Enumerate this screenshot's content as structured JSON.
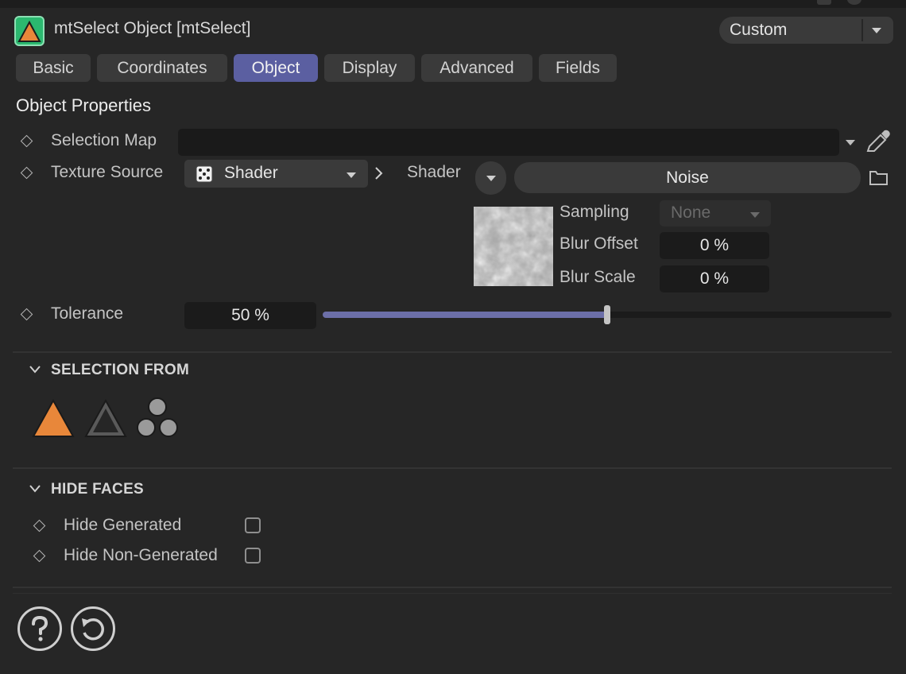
{
  "header": {
    "title": "mtSelect Object [mtSelect]",
    "preset": "Custom",
    "icon": "triangle-object-icon"
  },
  "tabs": [
    {
      "label": "Basic",
      "active": false
    },
    {
      "label": "Coordinates",
      "active": false
    },
    {
      "label": "Object",
      "active": true
    },
    {
      "label": "Display",
      "active": false
    },
    {
      "label": "Advanced",
      "active": false
    },
    {
      "label": "Fields",
      "active": false
    }
  ],
  "section_title": "Object Properties",
  "selection_map": {
    "label": "Selection Map",
    "value": ""
  },
  "texture_source": {
    "label": "Texture Source",
    "value": "Shader"
  },
  "shader": {
    "label": "Shader",
    "name": "Noise",
    "sampling_label": "Sampling",
    "sampling_value": "None",
    "blur_offset_label": "Blur Offset",
    "blur_offset_value": "0 %",
    "blur_scale_label": "Blur Scale",
    "blur_scale_value": "0 %"
  },
  "tolerance": {
    "label": "Tolerance",
    "value": "50 %",
    "fraction": 0.5
  },
  "selection_from": {
    "title": "SELECTION FROM",
    "icons": [
      "polygon-filled-icon",
      "polygon-outline-icon",
      "points-icon"
    ]
  },
  "hide_faces": {
    "title": "HIDE FACES",
    "items": [
      {
        "label": "Hide Generated",
        "checked": false
      },
      {
        "label": "Hide Non-Generated",
        "checked": false
      }
    ]
  },
  "footer": {
    "icons": [
      "help-icon",
      "reset-icon"
    ]
  },
  "colors": {
    "accent": "#5b5fa1",
    "slider": "#6c6fa8",
    "orange": "#e8873a",
    "green": "#2bb86f"
  }
}
